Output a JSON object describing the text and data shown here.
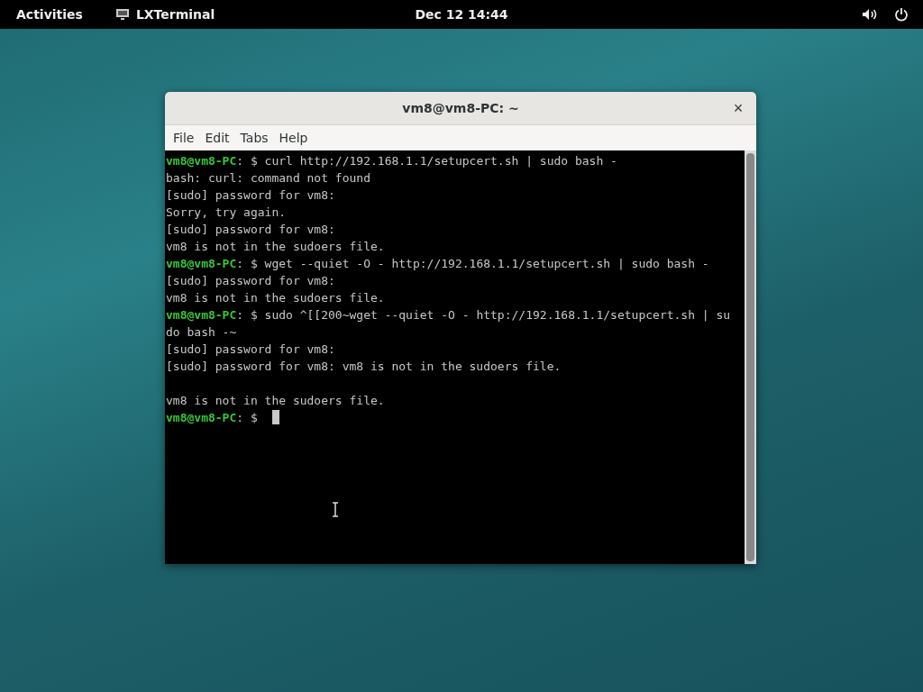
{
  "top_bar": {
    "activities": "Activities",
    "app_name": "LXTerminal",
    "clock": "Dec 12  14:44"
  },
  "window": {
    "title": "vm8@vm8-PC: ~",
    "close": "×"
  },
  "menu": [
    "File",
    "Edit",
    "Tabs",
    "Help"
  ],
  "terminal": {
    "lines": [
      {
        "kind": "prompt",
        "prompt": "vm8@vm8-PC",
        "text": ": $ curl http://192.168.1.1/setupcert.sh | sudo bash -"
      },
      {
        "kind": "output",
        "text": "bash: curl: command not found"
      },
      {
        "kind": "output",
        "text": "[sudo] password for vm8:"
      },
      {
        "kind": "output",
        "text": "Sorry, try again."
      },
      {
        "kind": "output",
        "text": "[sudo] password for vm8:"
      },
      {
        "kind": "output",
        "text": "vm8 is not in the sudoers file."
      },
      {
        "kind": "prompt",
        "prompt": "vm8@vm8-PC",
        "text": ": $ wget --quiet -O - http://192.168.1.1/setupcert.sh | sudo bash -"
      },
      {
        "kind": "output",
        "text": "[sudo] password for vm8:"
      },
      {
        "kind": "output",
        "text": "vm8 is not in the sudoers file."
      },
      {
        "kind": "prompt",
        "prompt": "vm8@vm8-PC",
        "text": ": $ sudo ^[[200~wget --quiet -O - http://192.168.1.1/setupcert.sh | su"
      },
      {
        "kind": "output",
        "text": "do bash -~"
      },
      {
        "kind": "output",
        "text": "[sudo] password for vm8:"
      },
      {
        "kind": "output",
        "text": "[sudo] password for vm8: vm8 is not in the sudoers file."
      },
      {
        "kind": "blank"
      },
      {
        "kind": "output",
        "text": "vm8 is not in the sudoers file."
      },
      {
        "kind": "input",
        "prompt": "vm8@vm8-PC",
        "text": ": $"
      }
    ]
  }
}
